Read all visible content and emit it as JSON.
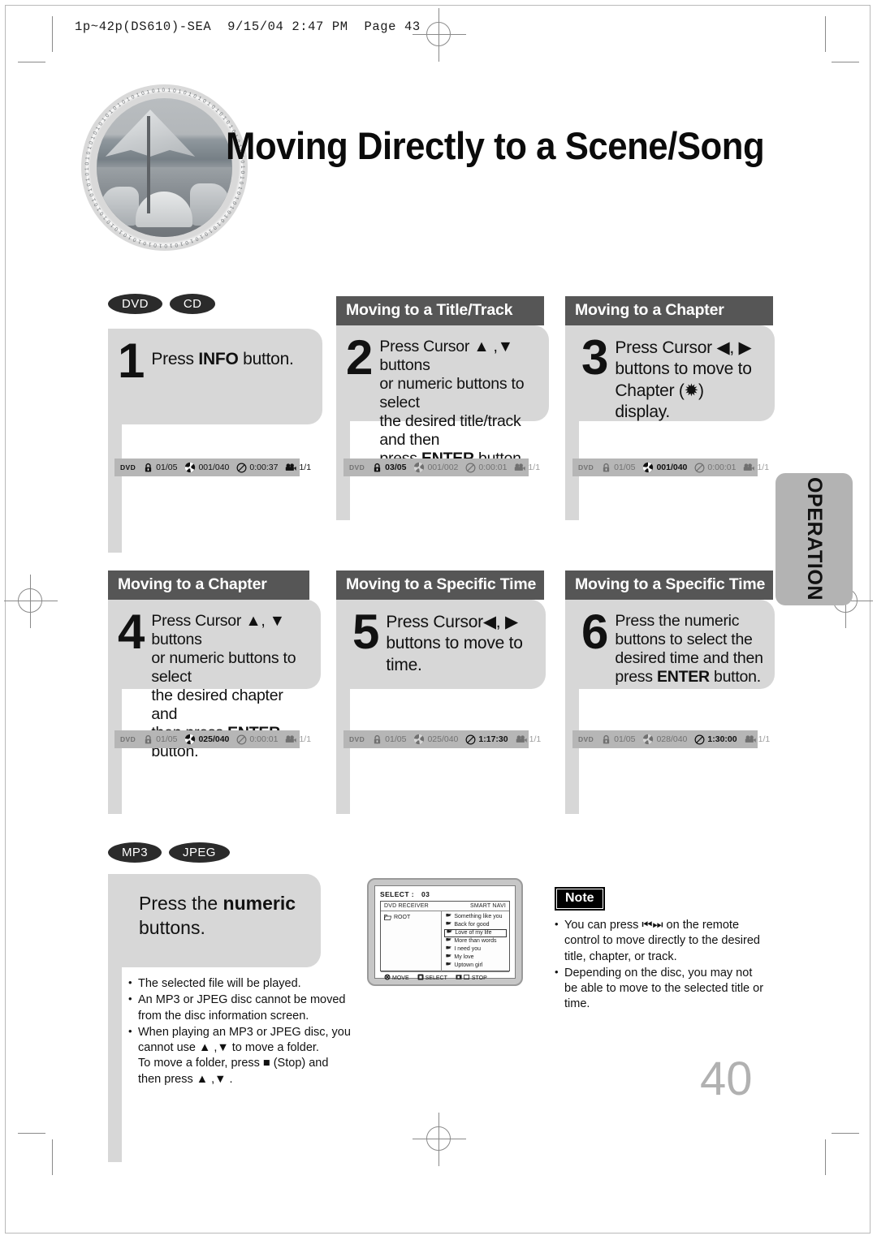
{
  "doc": {
    "header": "1p~42p(DS610)-SEA  9/15/04 2:47 PM  Page 43",
    "title": "Moving Directly to a Scene/Song",
    "page_number": "40",
    "side_tab": "OPERATION"
  },
  "badges": {
    "top": [
      "DVD",
      "CD"
    ],
    "bottom": [
      "MP3",
      "JPEG"
    ]
  },
  "steps": [
    {
      "heading": "",
      "number": "1",
      "text_html": "Press <b>INFO</b> button.",
      "osd": {
        "label": "DVD",
        "title": "01/05",
        "chapter": "001/040",
        "time": "0:00:37",
        "angle": "1/1",
        "active": "none"
      }
    },
    {
      "heading": "Moving to a Title/Track",
      "number": "2",
      "text_html": "Press Cursor ▲ ,▼ buttons<br>or numeric buttons to select<br>the desired title/track and then<br>press <b>ENTER</b> button.",
      "osd": {
        "label": "DVD",
        "title": "03/05",
        "chapter": "001/002",
        "time": "0:00:01",
        "angle": "1/1",
        "active": "title"
      }
    },
    {
      "heading": "Moving to a Chapter",
      "number": "3",
      "text_html": "Press Cursor ◀, ▶<br>buttons to move to<br>Chapter (✹)<br>display.",
      "osd": {
        "label": "DVD",
        "title": "01/05",
        "chapter": "001/040",
        "time": "0:00:01",
        "angle": "1/1",
        "active": "chapter"
      }
    },
    {
      "heading": "Moving to a Chapter",
      "number": "4",
      "text_html": "Press Cursor ▲, ▼ buttons<br>or numeric buttons to select<br>the desired chapter and<br>then press <b>ENTER</b> button.",
      "osd": {
        "label": "DVD",
        "title": "01/05",
        "chapter": "025/040",
        "time": "0:00:01",
        "angle": "1/1",
        "active": "chapter"
      }
    },
    {
      "heading": "Moving to a Specific Time",
      "number": "5",
      "text_html": "Press Cursor◀, ▶<br>buttons to move to<br>time.",
      "osd": {
        "label": "DVD",
        "title": "01/05",
        "chapter": "025/040",
        "time": "1:17:30",
        "angle": "1/1",
        "active": "time"
      }
    },
    {
      "heading": "Moving to a Specific Time",
      "number": "6",
      "text_html": "Press the numeric<br>buttons to select the<br>desired time and then<br>press <b>ENTER</b> button.",
      "osd": {
        "label": "DVD",
        "title": "01/05",
        "chapter": "028/040",
        "time": "1:30:00",
        "angle": "1/1",
        "active": "time"
      }
    }
  ],
  "mp3_section": {
    "text_html": "Press the <b>numeric</b><br>buttons.",
    "bullets": [
      {
        "main": "The selected file will be played.",
        "sub": []
      },
      {
        "main": "An MP3 or JPEG disc cannot be moved",
        "sub": [
          "from the disc information screen."
        ]
      },
      {
        "main": "When playing an MP3 or JPEG disc, you",
        "sub": [
          "cannot use ▲ ,▼  to move a folder.",
          "To move a folder, press ■ (Stop) and",
          "then press ▲ ,▼ ."
        ]
      }
    ]
  },
  "tv_screen": {
    "select_label": "SELECT :",
    "select_value": "03",
    "top_left": "DVD RECEIVER",
    "top_right": "SMART NAVI",
    "folder": "ROOT",
    "songs": [
      "Something like you",
      "Back for good",
      "Love of my life",
      "More than words",
      "I need you",
      "My love",
      "Uptown girl"
    ],
    "selected_song_index": 2,
    "buttons": [
      "MOVE",
      "SELECT",
      "STOP"
    ]
  },
  "note": {
    "badge": "Note",
    "bullets": [
      {
        "lines": [
          "You can press ⏮ ⏭ on the remote",
          "control to move directly to the desired",
          "title, chapter, or track."
        ]
      },
      {
        "lines": [
          "Depending on the disc, you may not",
          "be able to move to the selected title or",
          "time."
        ]
      }
    ]
  },
  "colors": {
    "panel_gray": "#d7d7d7",
    "heading_gray": "#565656",
    "osd_gray": "#b6b6b6",
    "badge_black": "#2b2b2b"
  }
}
